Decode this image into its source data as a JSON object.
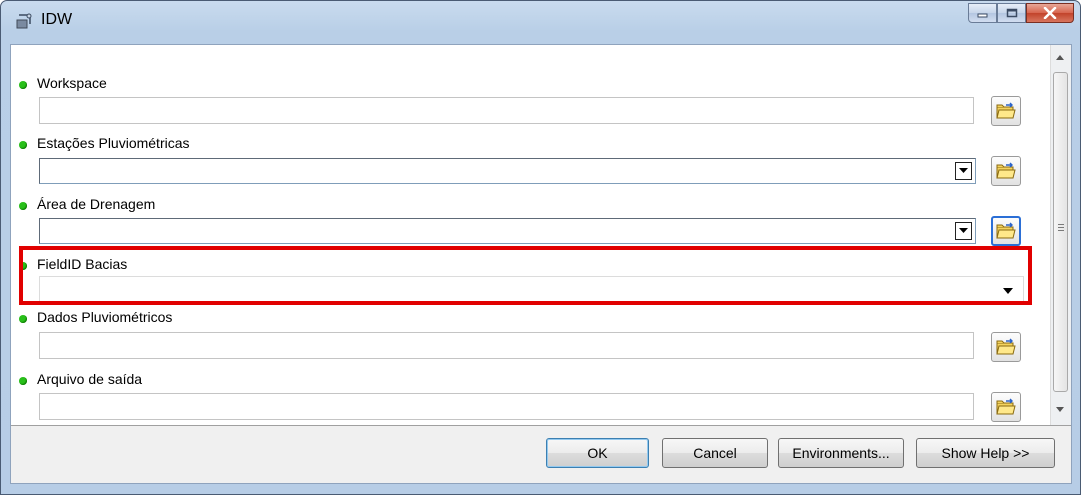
{
  "window": {
    "title": "IDW"
  },
  "params": [
    {
      "label": "Workspace",
      "value": ""
    },
    {
      "label": "Estações Pluviométricas",
      "value": ""
    },
    {
      "label": "Área de Drenagem",
      "value": ""
    },
    {
      "label": "FieldID Bacias",
      "value": ""
    },
    {
      "label": "Dados Pluviométricos",
      "value": ""
    },
    {
      "label": "Arquivo de saída",
      "value": ""
    }
  ],
  "buttons": {
    "ok": "OK",
    "cancel": "Cancel",
    "environments": "Environments...",
    "show_help": "Show Help >>"
  },
  "colors": {
    "required_dot": "#29c01a",
    "highlight": "#e10000",
    "title_bar": "#b9cfe7"
  },
  "icons": [
    "idw-tool-icon",
    "minimize-icon",
    "maximize-icon",
    "close-icon",
    "folder-browse-icon",
    "dropdown-arrow-icon"
  ]
}
